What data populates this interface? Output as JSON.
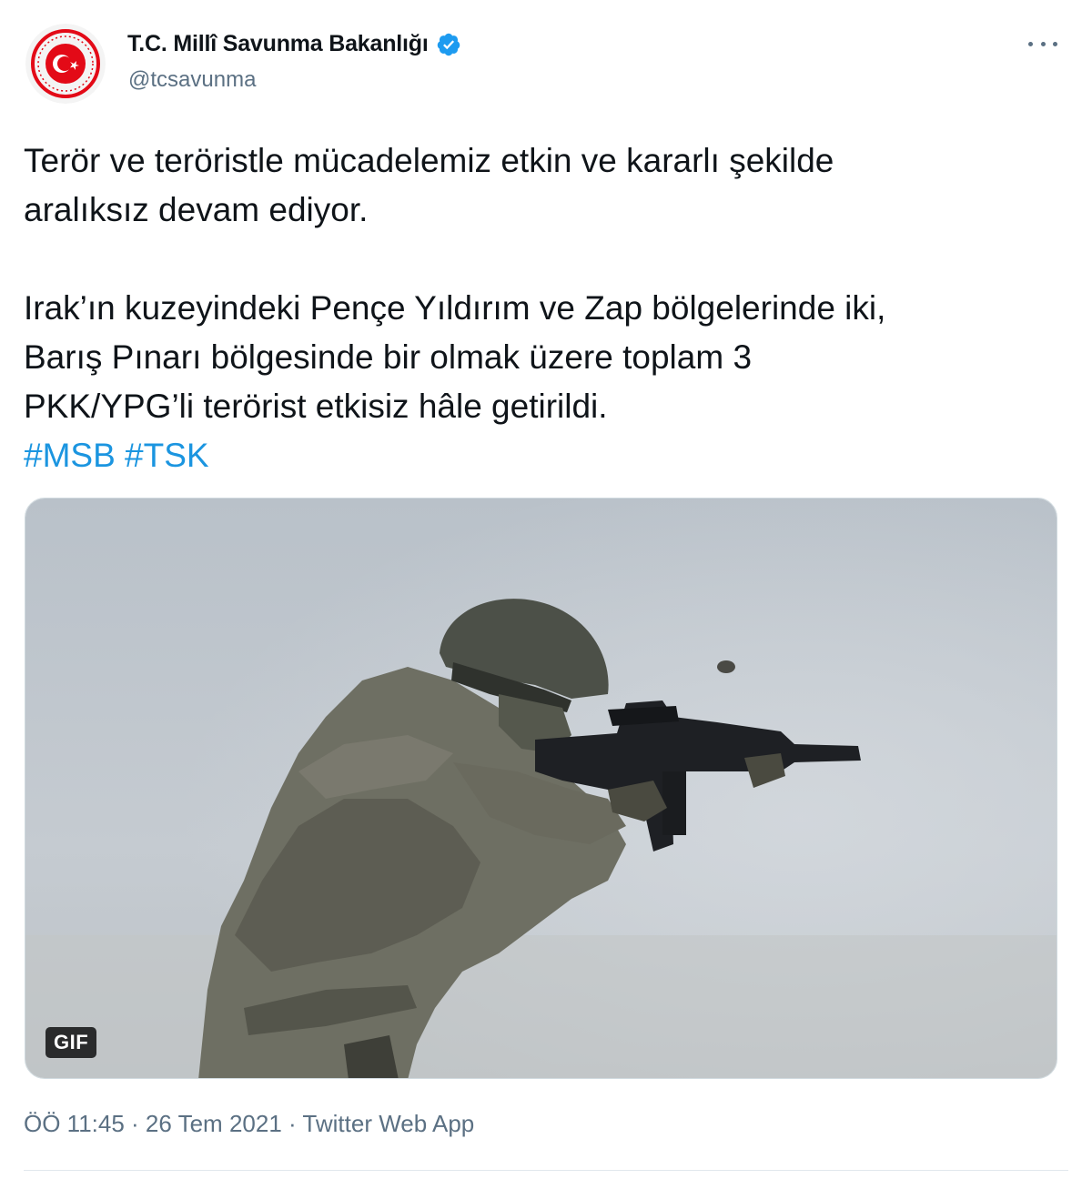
{
  "account": {
    "display_name": "T.C. Millî Savunma Bakanlığı",
    "handle": "@tcsavunma",
    "verified": true,
    "avatar_icon": "msb-seal-icon"
  },
  "tweet": {
    "line1": "Terör ve teröristle mücadelemiz etkin ve kararlı şekilde",
    "line2": "aralıksız devam ediyor.",
    "line3": "Irak’ın kuzeyindeki Pençe Yıldırım ve Zap bölgelerinde iki,",
    "line4": "Barış Pınarı bölgesinde bir olmak üzere toplam 3",
    "line5": "PKK/YPG’li terörist etkisiz hâle getirildi.",
    "hashtags": [
      "#MSB",
      "#TSK"
    ]
  },
  "media": {
    "type": "gif",
    "badge": "GIF"
  },
  "meta": {
    "time": "ÖÖ 11:45",
    "separator": " · ",
    "date": "26 Tem 2021",
    "source": "Twitter Web App"
  },
  "colors": {
    "link": "#1b95e0",
    "verified": "#1d9bf0",
    "secondary_text": "#5b7083",
    "seal_red": "#e30a17"
  }
}
